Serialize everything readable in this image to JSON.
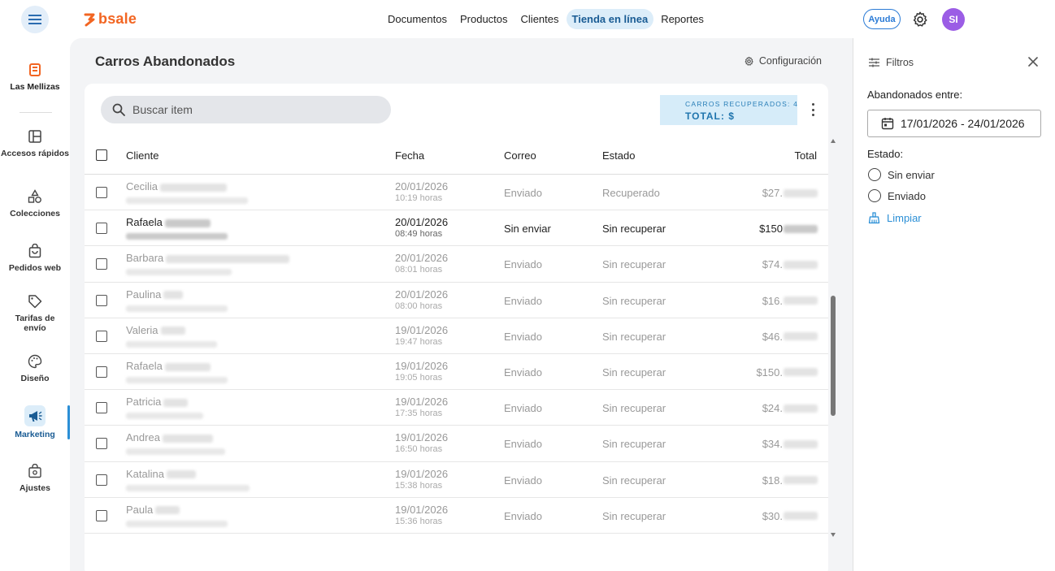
{
  "brand": {
    "name": "bsale",
    "color": "#f26522"
  },
  "nav": [
    {
      "label": "Documentos",
      "active": false
    },
    {
      "label": "Productos",
      "active": false
    },
    {
      "label": "Clientes",
      "active": false
    },
    {
      "label": "Tienda en línea",
      "active": true
    },
    {
      "label": "Reportes",
      "active": false
    }
  ],
  "header": {
    "help_label": "Ayuda",
    "avatar_initials": "SI"
  },
  "sidebar": {
    "store": "Las Mellizas",
    "items": [
      {
        "label": "Accesos rápidos",
        "icon": "grid-icon"
      },
      {
        "label": "Colecciones",
        "icon": "shapes-icon"
      },
      {
        "label": "Pedidos web",
        "icon": "bag-icon"
      },
      {
        "label": "Tarifas de envío",
        "icon": "tag-icon"
      },
      {
        "label": "Diseño",
        "icon": "palette-icon"
      },
      {
        "label": "Marketing",
        "icon": "megaphone-icon",
        "active": true
      },
      {
        "label": "Ajustes",
        "icon": "settings-bag-icon"
      }
    ]
  },
  "page": {
    "title": "Carros Abandonados",
    "config_label": "Configuración",
    "search_placeholder": "Buscar item",
    "recovered_label": "CARROS RECUPERADOS: 4",
    "total_label": "TOTAL: $"
  },
  "table": {
    "columns": [
      "Cliente",
      "Fecha",
      "Correo",
      "Estado",
      "Total"
    ],
    "rows": [
      {
        "name": "Cecilia",
        "date": "20/01/2026",
        "time": "10:19 horas",
        "email_status": "Enviado",
        "status": "Recuperado",
        "total": "$27.",
        "muted": true
      },
      {
        "name": "Rafaela",
        "date": "20/01/2026",
        "time": "08:49 horas",
        "email_status": "Sin enviar",
        "status": "Sin recuperar",
        "total": "$150",
        "muted": false
      },
      {
        "name": "Barbara",
        "date": "20/01/2026",
        "time": "08:01 horas",
        "email_status": "Enviado",
        "status": "Sin recuperar",
        "total": "$74.",
        "muted": true
      },
      {
        "name": "Paulina",
        "date": "20/01/2026",
        "time": "08:00 horas",
        "email_status": "Enviado",
        "status": "Sin recuperar",
        "total": "$16.",
        "muted": true
      },
      {
        "name": "Valeria",
        "date": "19/01/2026",
        "time": "19:47 horas",
        "email_status": "Enviado",
        "status": "Sin recuperar",
        "total": "$46.",
        "muted": true
      },
      {
        "name": "Rafaela",
        "date": "19/01/2026",
        "time": "19:05 horas",
        "email_status": "Enviado",
        "status": "Sin recuperar",
        "total": "$150.",
        "muted": true
      },
      {
        "name": "Patricia",
        "date": "19/01/2026",
        "time": "17:35 horas",
        "email_status": "Enviado",
        "status": "Sin recuperar",
        "total": "$24.",
        "muted": true
      },
      {
        "name": "Andrea",
        "date": "19/01/2026",
        "time": "16:50 horas",
        "email_status": "Enviado",
        "status": "Sin recuperar",
        "total": "$34.",
        "muted": true
      },
      {
        "name": "Katalina",
        "date": "19/01/2026",
        "time": "15:38 horas",
        "email_status": "Enviado",
        "status": "Sin recuperar",
        "total": "$18.",
        "muted": true
      },
      {
        "name": "Paula",
        "date": "19/01/2026",
        "time": "15:36 horas",
        "email_status": "Enviado",
        "status": "Sin recuperar",
        "total": "$30.",
        "muted": true
      }
    ]
  },
  "filters": {
    "title": "Filtros",
    "date_label": "Abandonados entre:",
    "date_range": "17/01/2026 - 24/01/2026",
    "status_label": "Estado:",
    "options": [
      "Sin enviar",
      "Enviado"
    ],
    "clear_label": "Limpiar"
  }
}
